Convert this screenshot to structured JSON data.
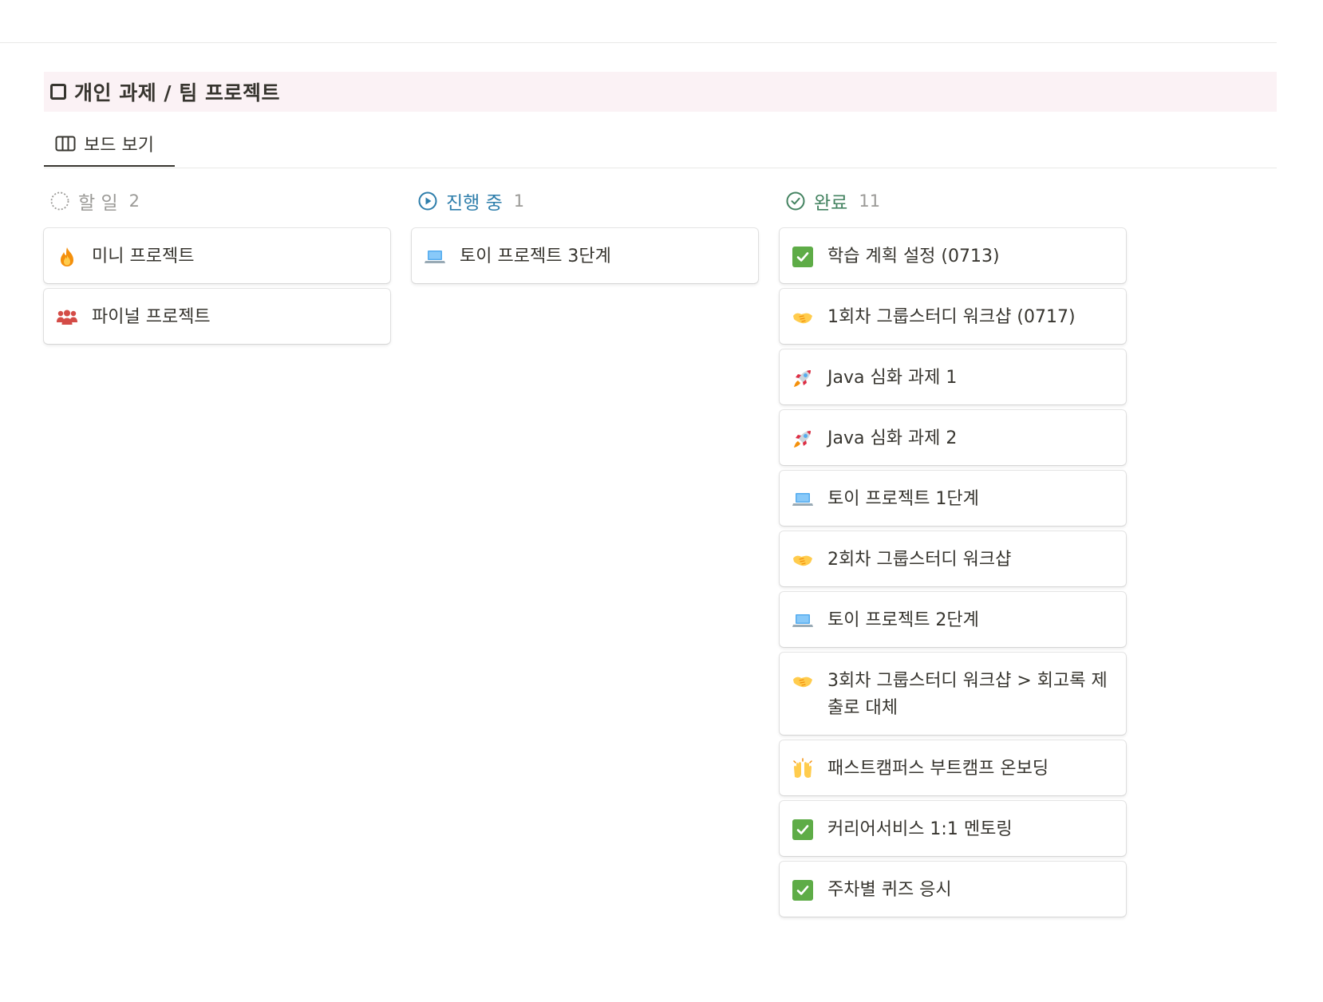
{
  "database": {
    "title": "개인 과제 / 팀 프로젝트",
    "view_tab": {
      "label": "보드 보기",
      "icon": "board-view-icon"
    }
  },
  "colors": {
    "header_bg": "#fbf2f5",
    "todo": "#9b9a97",
    "in_progress": "#2e7eab",
    "done": "#448361",
    "check_green": "#5eac47"
  },
  "columns": [
    {
      "status": "할 일",
      "count": "2",
      "icon": "dotted-circle-icon",
      "cards": [
        {
          "title": "미니 프로젝트",
          "icon": "fire-icon"
        },
        {
          "title": "파이널 프로젝트",
          "icon": "people-icon"
        }
      ]
    },
    {
      "status": "진행 중",
      "count": "1",
      "icon": "play-circle-icon",
      "cards": [
        {
          "title": "토이 프로젝트 3단계",
          "icon": "laptop-icon"
        }
      ]
    },
    {
      "status": "완료",
      "count": "11",
      "icon": "check-circle-icon",
      "cards": [
        {
          "title": "학습 계획 설정 (0713)",
          "icon": "check-mark-icon"
        },
        {
          "title": "1회차 그룹스터디 워크샵 (0717)",
          "icon": "handshake-icon"
        },
        {
          "title": "Java 심화 과제 1",
          "icon": "rocket-icon"
        },
        {
          "title": "Java 심화 과제 2",
          "icon": "rocket-icon"
        },
        {
          "title": "토이 프로젝트 1단계",
          "icon": "laptop-icon"
        },
        {
          "title": "2회차 그룹스터디 워크샵",
          "icon": "handshake-icon"
        },
        {
          "title": "토이 프로젝트 2단계",
          "icon": "laptop-icon"
        },
        {
          "title": "3회차 그룹스터디 워크샵 > 회고록 제출로 대체",
          "icon": "handshake-icon"
        },
        {
          "title": "패스트캠퍼스 부트캠프 온보딩",
          "icon": "raising-hands-icon"
        },
        {
          "title": "커리어서비스 1:1 멘토링",
          "icon": "check-mark-icon"
        },
        {
          "title": "주차별 퀴즈 응시",
          "icon": "check-mark-icon"
        }
      ]
    }
  ]
}
